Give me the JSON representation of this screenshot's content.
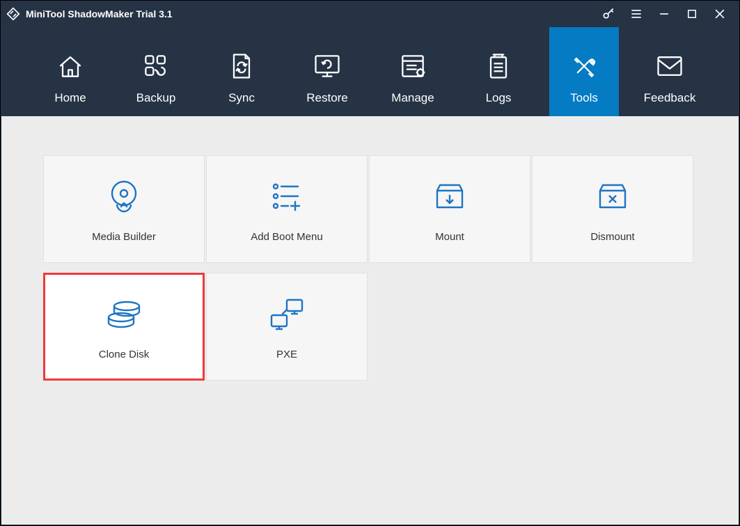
{
  "app": {
    "title": "MiniTool ShadowMaker Trial 3.1"
  },
  "nav": {
    "home": {
      "label": "Home"
    },
    "backup": {
      "label": "Backup"
    },
    "sync": {
      "label": "Sync"
    },
    "restore": {
      "label": "Restore"
    },
    "manage": {
      "label": "Manage"
    },
    "logs": {
      "label": "Logs"
    },
    "tools": {
      "label": "Tools"
    },
    "feedback": {
      "label": "Feedback"
    }
  },
  "tiles": {
    "media_builder": {
      "label": "Media Builder"
    },
    "add_boot_menu": {
      "label": "Add Boot Menu"
    },
    "mount": {
      "label": "Mount"
    },
    "dismount": {
      "label": "Dismount"
    },
    "clone_disk": {
      "label": "Clone Disk"
    },
    "pxe": {
      "label": "PXE"
    }
  },
  "colors": {
    "accent": "#047bc2",
    "icon_blue": "#1e74c4",
    "highlight_red": "#ef3a3a"
  }
}
